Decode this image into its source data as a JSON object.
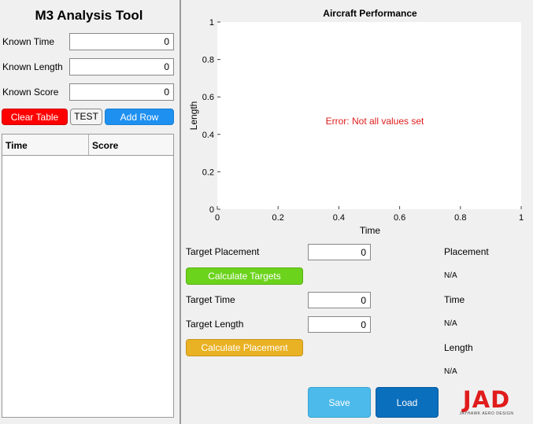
{
  "left_panel": {
    "title": "M3 Analysis Tool",
    "known_time_label": "Known Time",
    "known_time_value": "0",
    "known_length_label": "Known Length",
    "known_length_value": "0",
    "known_score_label": "Known Score",
    "known_score_value": "0",
    "clear_table_label": "Clear Table",
    "test_label": "TEST",
    "add_row_label": "Add Row",
    "table": {
      "columns": [
        "Time",
        "Score"
      ],
      "rows": []
    }
  },
  "plot": {
    "title": "Aircraft Performance",
    "xlabel": "Time",
    "ylabel": "Length",
    "error_text": "Error: Not all values set",
    "xticks": [
      "0",
      "0.2",
      "0.4",
      "0.6",
      "0.8",
      "1"
    ],
    "yticks": [
      "0",
      "0.2",
      "0.4",
      "0.6",
      "0.8",
      "1"
    ]
  },
  "controls": {
    "target_placement_label": "Target Placement",
    "target_placement_value": "0",
    "calculate_targets_label": "Calculate Targets",
    "target_time_label": "Target Time",
    "target_time_value": "0",
    "target_length_label": "Target Length",
    "target_length_value": "0",
    "calculate_placement_label": "Calculate Placement",
    "save_label": "Save",
    "load_label": "Load"
  },
  "results": {
    "placement_label": "Placement",
    "placement_value": "N/A",
    "time_label": "Time",
    "time_value": "N/A",
    "length_label": "Length",
    "length_value": "N/A"
  },
  "logo": {
    "text": "JAD",
    "subtext": "JAYHAWK AERO DESIGN"
  },
  "colors": {
    "clear_button": "#ff0000",
    "add_row_button": "#1e90f0",
    "calculate_targets_button": "#6cd31c",
    "calculate_placement_button": "#e9b124",
    "save_button": "#4cbaea",
    "load_button": "#0a6fbd",
    "error_text": "#e01c1c"
  }
}
